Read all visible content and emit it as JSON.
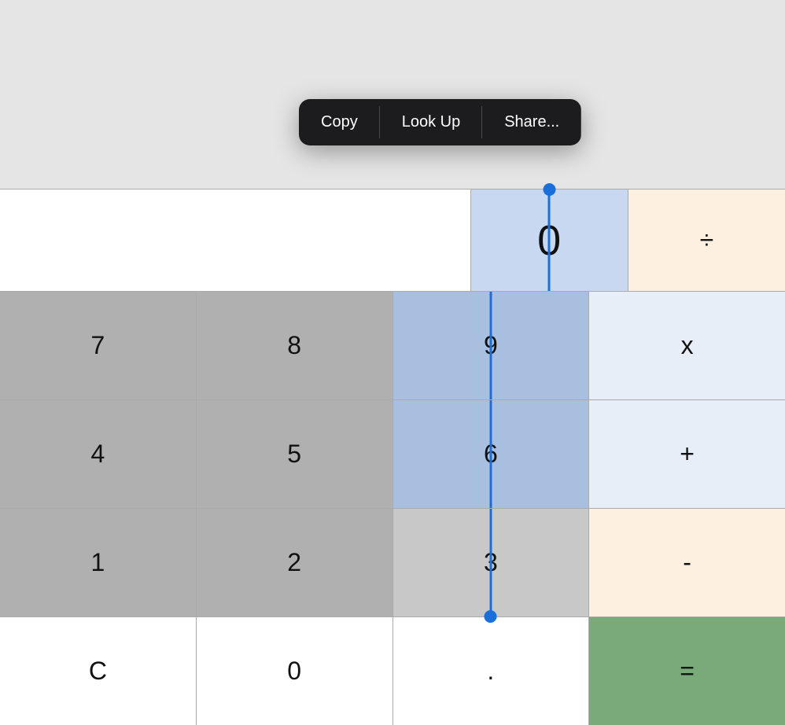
{
  "context_menu": {
    "items": [
      {
        "id": "copy",
        "label": "Copy"
      },
      {
        "id": "look_up",
        "label": "Look Up"
      },
      {
        "id": "share",
        "label": "Share..."
      }
    ]
  },
  "display": {
    "value": "0",
    "op": "÷"
  },
  "buttons": {
    "row1": [
      {
        "id": "7",
        "label": "7",
        "type": "gray"
      },
      {
        "id": "8",
        "label": "8",
        "type": "gray"
      },
      {
        "id": "9",
        "label": "9",
        "type": "selected"
      },
      {
        "id": "multiply",
        "label": "x",
        "type": "op_light"
      }
    ],
    "row2": [
      {
        "id": "4",
        "label": "4",
        "type": "gray"
      },
      {
        "id": "5",
        "label": "5",
        "type": "gray"
      },
      {
        "id": "6",
        "label": "6",
        "type": "selected"
      },
      {
        "id": "plus",
        "label": "+",
        "type": "op_light"
      }
    ],
    "row3": [
      {
        "id": "1",
        "label": "1",
        "type": "gray"
      },
      {
        "id": "2",
        "label": "2",
        "type": "gray"
      },
      {
        "id": "3",
        "label": "3",
        "type": "selected"
      },
      {
        "id": "minus",
        "label": "-",
        "type": "op"
      }
    ],
    "row4": [
      {
        "id": "clear",
        "label": "C",
        "type": "white"
      },
      {
        "id": "0",
        "label": "0",
        "type": "white"
      },
      {
        "id": "dot",
        "label": ".",
        "type": "white"
      },
      {
        "id": "equals",
        "label": "=",
        "type": "green"
      }
    ]
  }
}
